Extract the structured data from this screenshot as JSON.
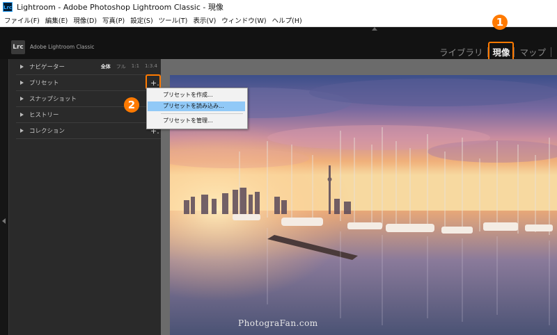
{
  "window": {
    "title": "Lightroom - Adobe Photoshop Lightroom Classic - 現像",
    "app_icon": "Lrc"
  },
  "menubar": [
    "ファイル(F)",
    "編集(E)",
    "現像(D)",
    "写真(P)",
    "設定(S)",
    "ツール(T)",
    "表示(V)",
    "ウィンドウ(W)",
    "ヘルプ(H)"
  ],
  "identity": {
    "logo": "Lrc",
    "brand": "Adobe Lightroom Classic",
    "modules": [
      "ライブラリ",
      "現像",
      "マップ"
    ]
  },
  "annotations": {
    "step1": "1",
    "step2": "2",
    "accent_color": "#ff7a00"
  },
  "left_panel": {
    "navigator": {
      "label": "ナビゲーター",
      "zoom_options": [
        "全体",
        "フル",
        "1:1",
        "1:3.4"
      ]
    },
    "presets": {
      "label": "プリセット",
      "add": "+."
    },
    "snapshots": {
      "label": "スナップショット",
      "add": "+."
    },
    "history": {
      "label": "ヒストリー"
    },
    "collections": {
      "label": "コレクション",
      "add": "+."
    }
  },
  "preset_menu": {
    "items": [
      "プリセットを作成...",
      "プリセットを読み込み...",
      "プリセットを管理..."
    ],
    "highlighted_index": 1
  },
  "photo": {
    "watermark": "PhotograFan.com",
    "description_icon": "marina-sunset-photo"
  }
}
